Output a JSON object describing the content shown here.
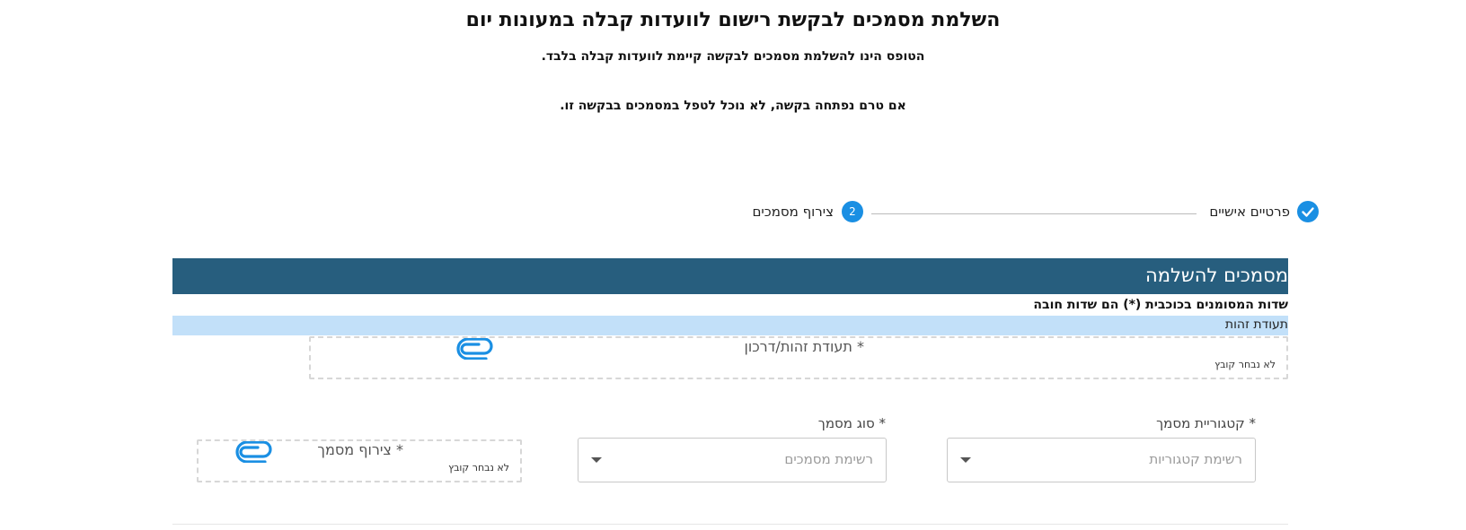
{
  "page": {
    "title": "השלמת מסמכים לבקשת רישום לוועדות קבלה במעונות יום",
    "subtitle_1": "הטופס הינו להשלמת מסמכים לבקשה קיימת לוועדות קבלה בלבד.",
    "subtitle_2": "אם טרם נפתחה בקשה, לא נוכל לטפל במסמכים בבקשה זו."
  },
  "stepper": {
    "steps": [
      {
        "label": "פרטיים אישיים",
        "state": "completed",
        "icon": "check-icon"
      },
      {
        "label": "צירוף מסמכים",
        "state": "active",
        "number": "2"
      }
    ],
    "accent_color": "#1a8fe3"
  },
  "section": {
    "title": "מסמכים להשלמה",
    "header_color": "#275e7e",
    "required_note": "שדות המסומנים בכוכבית (*) הם שדות חובה",
    "subsection_title": "תעודת זהות",
    "subsection_color": "#c2e0f9"
  },
  "id_upload": {
    "label": "* תעודת זהות/דרכון",
    "status": "לא נבחר קובץ",
    "icon": "paperclip-icon"
  },
  "category_select": {
    "label": "* קטגוריית מסמך",
    "placeholder": "רשימת קטגוריות"
  },
  "doc_type_select": {
    "label": "* סוג מסמך",
    "placeholder": "רשימת מסמכים"
  },
  "doc_upload": {
    "label": "* צירוף מסמך",
    "status": "לא נבחר קובץ",
    "icon": "paperclip-icon"
  }
}
